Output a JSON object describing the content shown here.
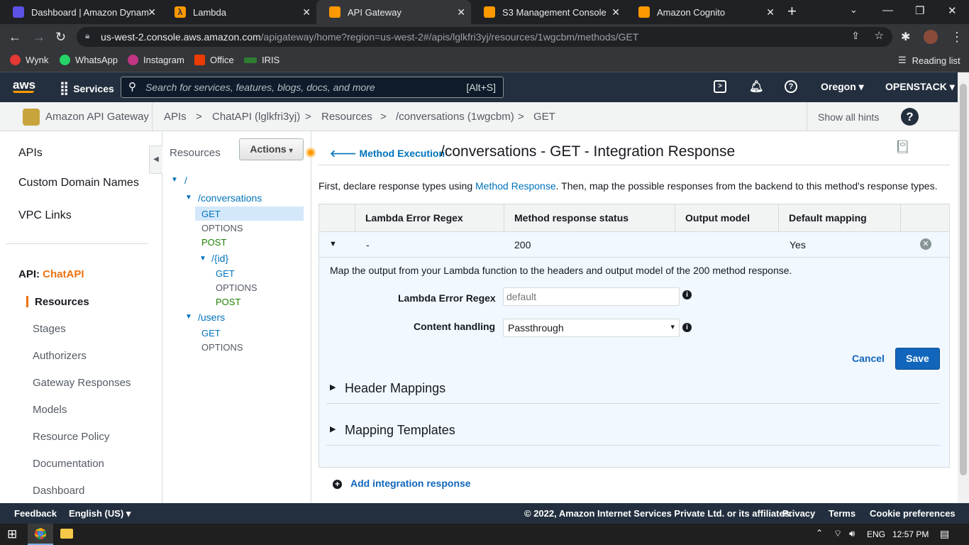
{
  "browser": {
    "tabs": [
      {
        "title": "Dashboard | Amazon Dynam",
        "color": "#5b52e5"
      },
      {
        "title": "Lambda",
        "color": "#ff9900"
      },
      {
        "title": "API Gateway",
        "color": "#ff9900"
      },
      {
        "title": "S3 Management Console",
        "color": "#ff9900"
      },
      {
        "title": "Amazon Cognito",
        "color": "#ff9900"
      }
    ],
    "url_host": "us-west-2.console.aws.amazon.com",
    "url_path": "/apigateway/home?region=us-west-2#/apis/lglkfri3yj/resources/1wgcbm/methods/GET",
    "bookmarks": [
      "Wynk",
      "WhatsApp",
      "Instagram",
      "Office",
      "IRIS"
    ],
    "reading_list": "Reading list"
  },
  "aws_nav": {
    "logo": "aws",
    "services": "Services",
    "search_placeholder": "Search for services, features, blogs, docs, and more",
    "search_shortcut": "[Alt+S]",
    "region": "Oregon",
    "account": "OPENSTACK"
  },
  "breadcrumbs": {
    "service": "Amazon API Gateway",
    "items": [
      "APIs",
      "ChatAPI (lglkfri3yj)",
      "Resources",
      "/conversations (1wgcbm)",
      "GET"
    ],
    "separator": ">",
    "hints": "Show all hints"
  },
  "left_nav": {
    "top": [
      "APIs",
      "Custom Domain Names",
      "VPC Links"
    ],
    "api_label": "API:",
    "api_name": "ChatAPI",
    "items": [
      "Resources",
      "Stages",
      "Authorizers",
      "Gateway Responses",
      "Models",
      "Resource Policy",
      "Documentation",
      "Dashboard"
    ]
  },
  "tree": {
    "title": "Resources",
    "actions": "Actions",
    "root": "/",
    "conversations": "/conversations",
    "conv_methods": [
      "GET",
      "OPTIONS",
      "POST"
    ],
    "id": "/{id}",
    "id_methods": [
      "GET",
      "OPTIONS",
      "POST"
    ],
    "users": "/users",
    "users_methods": [
      "GET",
      "OPTIONS"
    ]
  },
  "main": {
    "back_link": "Method Execution",
    "title": "/conversations - GET - Integration Response",
    "intro_before": "First, declare response types using ",
    "intro_link": "Method Response",
    "intro_after": ". Then, map the possible responses from the backend to this method's response types.",
    "columns": [
      "Lambda Error Regex",
      "Method response status",
      "Output model",
      "Default mapping"
    ],
    "row": {
      "regex": "-",
      "status": "200",
      "model": "",
      "default": "Yes"
    },
    "detail_text": "Map the output from your Lambda function to the headers and output model of the 200 method response.",
    "regex_label": "Lambda Error Regex",
    "regex_placeholder": "default",
    "content_label": "Content handling",
    "content_value": "Passthrough",
    "cancel": "Cancel",
    "save": "Save",
    "header_mappings": "Header Mappings",
    "mapping_templates": "Mapping Templates",
    "add_response": "Add integration response"
  },
  "footer": {
    "feedback": "Feedback",
    "language": "English (US)",
    "copyright": "© 2022, Amazon Internet Services Private Ltd. or its affiliates.",
    "links": [
      "Privacy",
      "Terms",
      "Cookie preferences"
    ]
  },
  "taskbar": {
    "lang": "ENG",
    "time": "12:57 PM"
  },
  "colors": {
    "aws_dark": "#232f3e",
    "aws_orange": "#ec7211",
    "link_blue": "#0073bb",
    "save_blue": "#1166bb",
    "method_green": "#1d8102"
  }
}
